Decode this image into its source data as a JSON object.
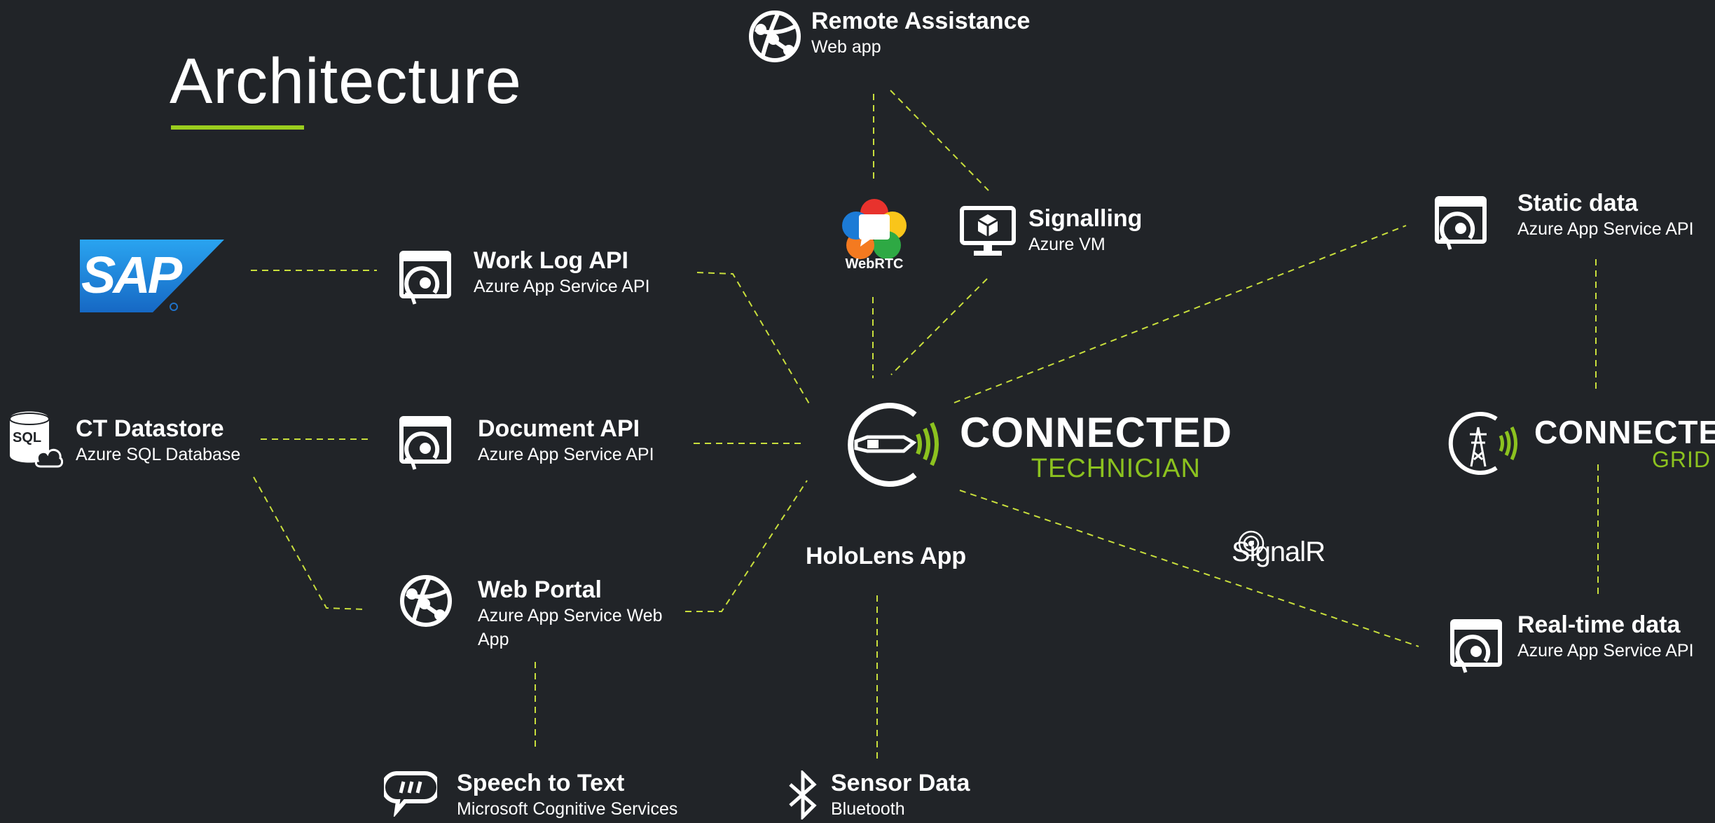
{
  "page": {
    "title": "Architecture"
  },
  "nodes": {
    "remote_assistance": {
      "title": "Remote Assistance",
      "subtitle": "Web app"
    },
    "signalling": {
      "title": "Signalling",
      "subtitle": "Azure VM"
    },
    "static_data": {
      "title": "Static data",
      "subtitle": "Azure App Service API"
    },
    "work_log_api": {
      "title": "Work Log API",
      "subtitle": "Azure App Service API"
    },
    "ct_datastore": {
      "title": "CT Datastore",
      "subtitle": "Azure SQL Database"
    },
    "document_api": {
      "title": "Document API",
      "subtitle": "Azure App Service API"
    },
    "web_portal": {
      "title": "Web Portal",
      "subtitle": "Azure App Service Web App"
    },
    "hololens_app": {
      "title": "HoloLens App"
    },
    "realtime_data": {
      "title": "Real-time data",
      "subtitle": "Azure App Service API"
    },
    "speech_to_text": {
      "title": "Speech to Text",
      "subtitle": "Microsoft Cognitive Services"
    },
    "sensor_data": {
      "title": "Sensor Data",
      "subtitle": "Bluetooth"
    }
  },
  "logos": {
    "sap": "SAP",
    "sql": "SQL",
    "webrtc": "WebRTC",
    "signalr": "SignalR",
    "connected_technician": {
      "main": "CONNECTED",
      "sub": "TECHNICIAN"
    },
    "connected_grid": {
      "main": "CONNECTED",
      "sub": "GRID"
    }
  },
  "icons": {
    "web_app": "globe-icon",
    "api": "app-service-api-icon",
    "vm": "virtual-machine-icon",
    "speech": "speech-bubble-icon",
    "bluetooth": "bluetooth-icon",
    "database": "sql-database-icon"
  },
  "colors": {
    "background": "#212428",
    "accent": "#9acd1e",
    "connector": "#c8de3c",
    "text": "#ffffff",
    "sap_blue": "#1f72c9"
  }
}
